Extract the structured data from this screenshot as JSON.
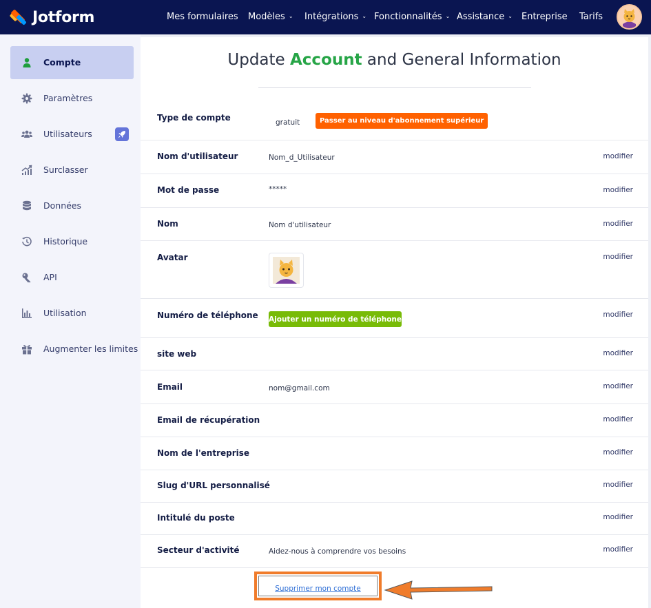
{
  "app": {
    "logo_text": "Jotform",
    "brand_colors": {
      "navy": "#0a1551",
      "orange": "#ff6100",
      "green": "#27a547",
      "lime": "#78bb07"
    }
  },
  "nav": {
    "items": [
      {
        "label": "Mes formulaires",
        "has_caret": false
      },
      {
        "label": "Modèles",
        "has_caret": true
      },
      {
        "label": "Intégrations",
        "has_caret": true
      },
      {
        "label": "Fonctionnalités",
        "has_caret": true
      },
      {
        "label": "Assistance",
        "has_caret": true
      },
      {
        "label": "Entreprise",
        "has_caret": false
      },
      {
        "label": "Tarifs",
        "has_caret": false
      }
    ],
    "caret_glyph": "⌄"
  },
  "sidebar": {
    "items": [
      {
        "label": "Compte",
        "icon": "user-icon",
        "active": true
      },
      {
        "label": "Paramètres",
        "icon": "gear-icon",
        "active": false
      },
      {
        "label": "Utilisateurs",
        "icon": "users-icon",
        "active": false,
        "badge": "rocket-icon"
      },
      {
        "label": "Surclasser",
        "icon": "chart-upgrade-icon",
        "active": false
      },
      {
        "label": "Données",
        "icon": "database-icon",
        "active": false
      },
      {
        "label": "Historique",
        "icon": "history-icon",
        "active": false
      },
      {
        "label": "API",
        "icon": "key-icon",
        "active": false
      },
      {
        "label": "Utilisation",
        "icon": "bar-chart-icon",
        "active": false
      },
      {
        "label": "Augmenter les limites",
        "icon": "gift-icon",
        "active": false
      }
    ]
  },
  "main": {
    "title_before": "Update ",
    "title_accent": "Account",
    "title_after": " and General Information",
    "edit_label": "modifier",
    "account_type": {
      "label": "Type de compte",
      "plan": "gratuit",
      "upgrade_button": "Passer au niveau d'abonnement supérieur"
    },
    "rows": {
      "username": {
        "label": "Nom d'utilisateur",
        "value": "Nom_d_Utilisateur"
      },
      "password": {
        "label": "Mot de passe",
        "value": "*****"
      },
      "name": {
        "label": "Nom",
        "value": "Nom d'utilisateur"
      },
      "avatar": {
        "label": "Avatar"
      },
      "phone": {
        "label": "Numéro de téléphone",
        "button": "Ajouter un numéro de téléphone"
      },
      "website": {
        "label": "site web"
      },
      "email": {
        "label": "Email",
        "value": "nom@gmail.com"
      },
      "recovery_email": {
        "label": "Email de récupération"
      },
      "company": {
        "label": "Nom de l'entreprise"
      },
      "slug": {
        "label": "Slug d'URL personnalisé"
      },
      "job_title": {
        "label": "Intitulé du poste"
      },
      "industry": {
        "label": "Secteur d'activité",
        "value": "Aidez-nous à comprendre vos besoins"
      }
    },
    "delete_link": "Supprimer mon compte",
    "highlight_color": "#f07c2b"
  }
}
